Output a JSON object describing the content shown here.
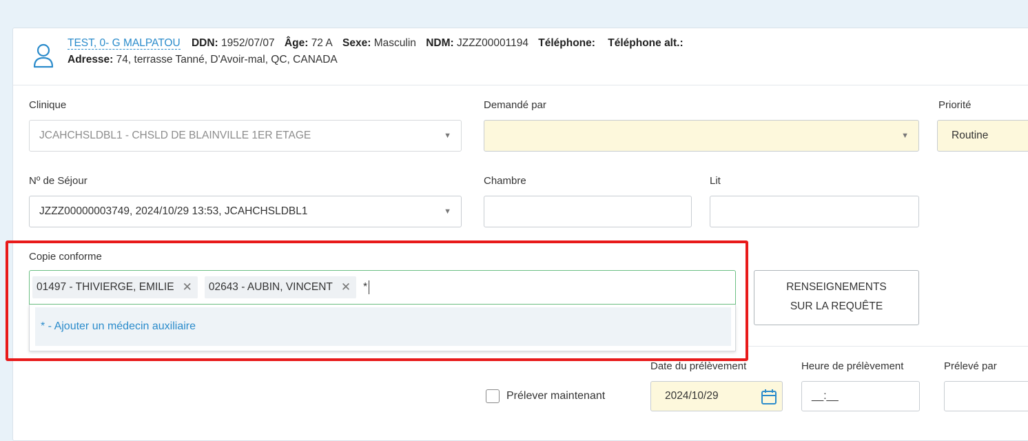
{
  "patient": {
    "name": "TEST, 0- G MALPATOU",
    "ddn_label": "DDN:",
    "ddn": "1952/07/07",
    "age_label": "Âge:",
    "age": "72 A",
    "sexe_label": "Sexe:",
    "sexe": "Masculin",
    "ndm_label": "NDM:",
    "ndm": "JZZZ00001194",
    "tel_label": "Téléphone:",
    "tel_alt_label": "Téléphone alt.:",
    "adresse_label": "Adresse:",
    "adresse": "74, terrasse Tanné, D'Avoir-mal, QC, CANADA"
  },
  "form": {
    "clinique_label": "Clinique",
    "clinique_value": "JCAHCHSLDBL1 - CHSLD DE BLAINVILLE 1ER ETAGE",
    "demande_label": "Demandé par",
    "demande_value": "",
    "priorite_label": "Priorité",
    "priorite_value": "Routine",
    "sejour_label": "Nº de Séjour",
    "sejour_value": "JZZZ00000003749, 2024/10/29 13:53, JCAHCHSLDBL1",
    "chambre_label": "Chambre",
    "lit_label": "Lit",
    "copie_label": "Copie conforme",
    "copie_chips": [
      "01497 - THIVIERGE, EMILIE",
      "02643 - AUBIN, VINCENT"
    ],
    "copie_typed": "*",
    "copie_option": "* - Ajouter un médecin auxiliaire",
    "renseignements_line1": "RENSEIGNEMENTS",
    "renseignements_line2": "SUR LA REQUÊTE",
    "prelever_maintenant_label": "Prélever maintenant",
    "date_prelevement_label": "Date du prélèvement",
    "date_prelevement_value": "2024/10/29",
    "heure_prelevement_label": "Heure de prélèvement",
    "heure_prelevement_value": "__:__",
    "preleve_par_label": "Prélevé par"
  },
  "colors": {
    "accent": "#2a8bcb",
    "highlight": "#e81a1a",
    "focus_border": "#6bbf83",
    "required_bg": "#fdf8dc"
  }
}
